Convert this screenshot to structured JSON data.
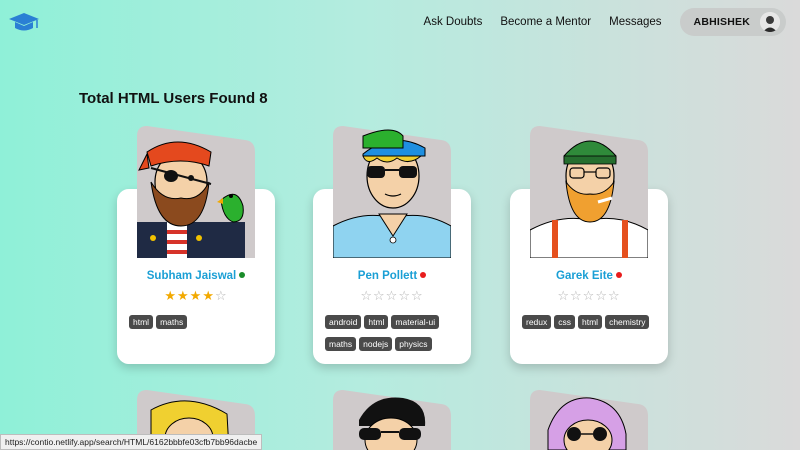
{
  "nav": {
    "links": [
      "Ask Doubts",
      "Become a Mentor",
      "Messages"
    ],
    "profile_name": "ABHISHEK"
  },
  "heading": "Total HTML Users Found 8",
  "cards": [
    {
      "name": "Subham Jaiswal",
      "status": "online",
      "status_color": "#1a8c2a",
      "rating": 4,
      "max_rating": 5,
      "tags": [
        "html",
        "maths"
      ]
    },
    {
      "name": "Pen Pollett",
      "status": "offline",
      "status_color": "#e81c1c",
      "rating": 0,
      "max_rating": 5,
      "tags": [
        "android",
        "html",
        "material-ui",
        "maths",
        "nodejs",
        "physics"
      ]
    },
    {
      "name": "Garek Eite",
      "status": "offline",
      "status_color": "#e81c1c",
      "rating": 0,
      "max_rating": 5,
      "tags": [
        "redux",
        "css",
        "html",
        "chemistry"
      ]
    }
  ],
  "status_bar_url": "https://contio.netlify.app/search/HTML/6162bbbfe03cfb7bb96dacbe",
  "colors": {
    "accent": "#1a9fd5",
    "brand": "#2a7fd4",
    "star": "#f2a900"
  }
}
